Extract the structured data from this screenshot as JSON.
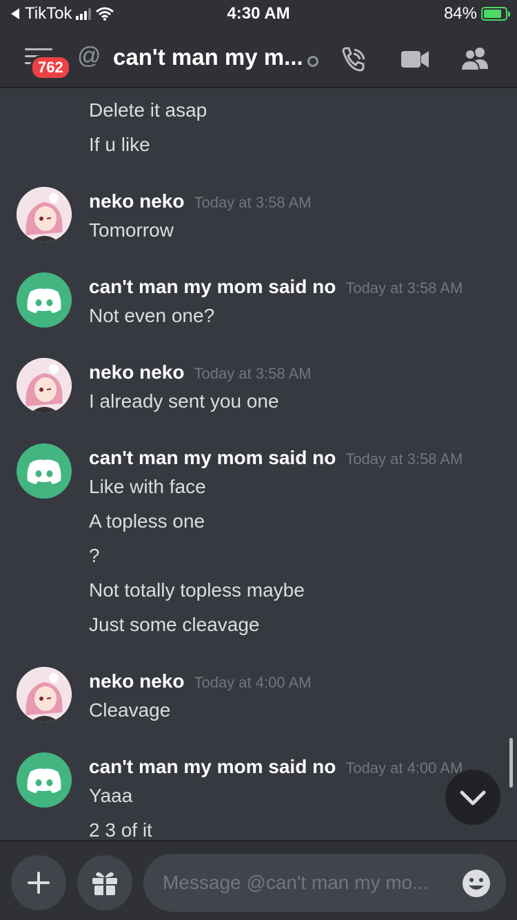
{
  "status_bar": {
    "back_app": "TikTok",
    "time": "4:30 AM",
    "battery_percent": "84%",
    "battery_level": 0.84
  },
  "header": {
    "mention_count": "762",
    "channel_name": "can't man my m...",
    "icons": [
      "menu-icon",
      "at-icon",
      "phone-call-icon",
      "video-camera-icon",
      "members-icon"
    ]
  },
  "messages": [
    {
      "group": 0,
      "author": "",
      "timestamp": "",
      "avatar": "",
      "lines": [
        "Delete it asap",
        "If u like"
      ]
    },
    {
      "group": 1,
      "author": "neko neko",
      "timestamp": "Today at 3:58 AM",
      "avatar": "neko",
      "lines": [
        "Tomorrow"
      ]
    },
    {
      "group": 2,
      "author": "can't man my mom said no",
      "timestamp": "Today at 3:58 AM",
      "avatar": "discord",
      "lines": [
        "Not even one?"
      ]
    },
    {
      "group": 3,
      "author": "neko neko",
      "timestamp": "Today at 3:58 AM",
      "avatar": "neko",
      "lines": [
        "I already sent you one"
      ]
    },
    {
      "group": 4,
      "author": "can't man my mom said no",
      "timestamp": "Today at 3:58 AM",
      "avatar": "discord",
      "lines": [
        "Like with face",
        "A topless one",
        "?",
        "Not totally topless maybe",
        "Just some cleavage"
      ]
    },
    {
      "group": 5,
      "author": "neko neko",
      "timestamp": "Today at 4:00 AM",
      "avatar": "neko",
      "lines": [
        "Cleavage"
      ]
    },
    {
      "group": 6,
      "author": "can't man my mom said no",
      "timestamp": "Today at 4:00 AM",
      "avatar": "discord",
      "lines": [
        "Yaaa",
        "2 3 of it"
      ]
    }
  ],
  "composer": {
    "placeholder": "Message @can't man my mo...",
    "icons": [
      "plus-icon",
      "gift-icon",
      "emoji-icon"
    ]
  },
  "colors": {
    "background": "#36393f",
    "header": "#2f3136",
    "discord_green": "#43b581",
    "badge_red": "#ed4245",
    "battery_green": "#4cd964"
  }
}
